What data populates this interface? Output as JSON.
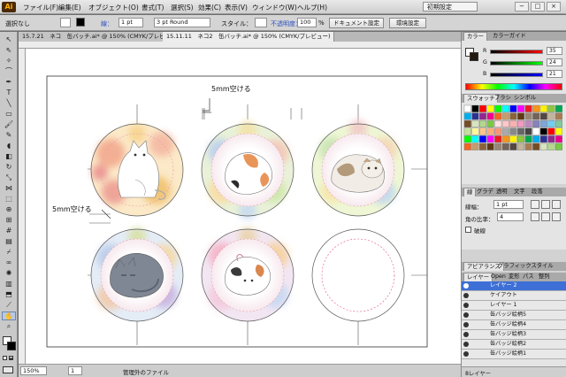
{
  "menubar": {
    "app_badge": "Ai",
    "items": [
      "ファイル(F)",
      "編集(E)",
      "オブジェクト(O)",
      "書式(T)",
      "選択(S)",
      "効果(C)",
      "表示(V)",
      "ウィンドウ(W)",
      "ヘルプ(H)"
    ],
    "workspace": "初期設定",
    "win_buttons": [
      "−",
      "□",
      "×"
    ]
  },
  "controlbar": {
    "selection": "選択なし",
    "stroke_label": "線：",
    "stroke_width": "1 pt",
    "brush": "3 pt Round",
    "style_label": "スタイル：",
    "opacity_label": "不透明度：",
    "opacity_value": "100",
    "opacity_unit": "%",
    "doc_setup_button": "ドキュメント設定",
    "prefs_button": "環境設定"
  },
  "tabs": [
    {
      "label": "15.7.21　ネコ　缶バッチ.ai* @ 150% (CMYK/プレビュー)",
      "active": false
    },
    {
      "label": "15.11.11　ネコ2　缶バッチ.ai* @ 150% (CMYK/プレビュー)",
      "active": true
    }
  ],
  "artboard": {
    "annotation_top": "5mm空ける",
    "annotation_left": "5mm空ける"
  },
  "badges": [
    {
      "name": "badge-cat-tabby-white",
      "cat": "white"
    },
    {
      "name": "badge-cat-calico-sleeping",
      "cat": "calico"
    },
    {
      "name": "badge-cat-scottish-fold",
      "cat": "fold"
    },
    {
      "name": "badge-cat-gray-curled",
      "cat": "gray"
    },
    {
      "name": "badge-cat-calico-rolling",
      "cat": "calico2"
    },
    {
      "name": "badge-empty-template",
      "cat": "none"
    }
  ],
  "statusbar": {
    "zoom": "150%",
    "page": "1",
    "status_text": "管理外のファイル"
  },
  "panels": {
    "color": {
      "tabs": [
        "カラー",
        "カラーガイド"
      ],
      "channels": [
        {
          "label": "R",
          "value": "35"
        },
        {
          "label": "G",
          "value": "24"
        },
        {
          "label": "B",
          "value": "21"
        }
      ]
    },
    "swatches": {
      "tabs": [
        "スウォッチ",
        "ブラシ",
        "シンボル"
      ]
    },
    "stroke": {
      "tabs": [
        "線",
        "グラデ",
        "透明",
        "文字",
        "段落"
      ],
      "weight_label": "線幅：",
      "weight_value": "1 pt",
      "corner_label": "角の比率：",
      "corner_value": "4",
      "dash_label": "破線"
    },
    "appearance": {
      "tabs": [
        "アピアランス",
        "グラフィックスタイル"
      ]
    },
    "layers": {
      "tabs": [
        "レイヤー",
        "Open",
        "変形",
        "パス",
        "整列"
      ],
      "items": [
        {
          "name": "レイヤー 2",
          "selected": true
        },
        {
          "name": "ケイアウト",
          "selected": false
        },
        {
          "name": "レイヤー 1",
          "selected": false
        },
        {
          "name": "缶バッジ絵柄5",
          "selected": false
        },
        {
          "name": "缶バッジ絵柄4",
          "selected": false
        },
        {
          "name": "缶バッジ絵柄3",
          "selected": false
        },
        {
          "name": "缶バッジ絵柄2",
          "selected": false
        },
        {
          "name": "缶バッジ絵柄1",
          "selected": false
        }
      ],
      "count": "8レイヤー"
    }
  }
}
